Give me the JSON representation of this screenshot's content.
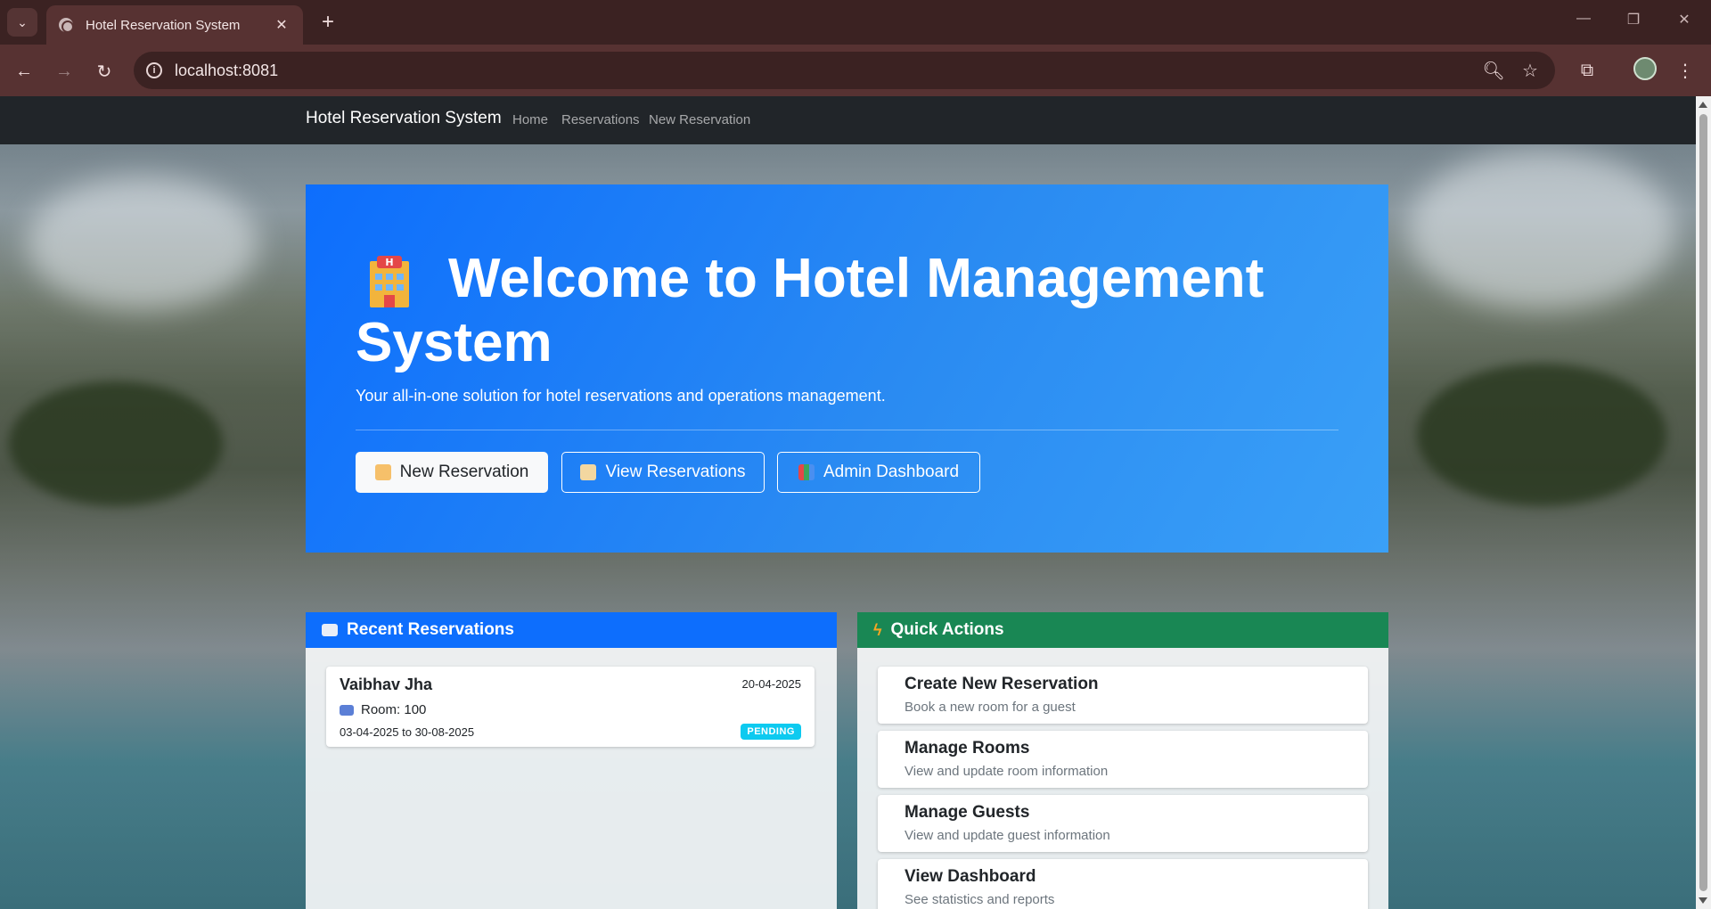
{
  "browser": {
    "tab_title": "Hotel Reservation System",
    "url": "localhost:8081"
  },
  "navbar": {
    "brand": "Hotel Reservation System",
    "links": [
      "Home",
      "Reservations",
      "New Reservation"
    ]
  },
  "hero": {
    "title": "Welcome to Hotel Management System",
    "subtitle": "Your all-in-one solution for hotel reservations and operations management.",
    "buttons": [
      "New Reservation",
      "View Reservations",
      "Admin Dashboard"
    ]
  },
  "recent": {
    "header": "Recent Reservations",
    "items": [
      {
        "guest": "Vaibhav Jha",
        "date": "20-04-2025",
        "room": "Room: 100",
        "range": "03-04-2025 to 30-08-2025",
        "status": "PENDING"
      }
    ]
  },
  "quick_actions": {
    "header": "Quick Actions",
    "items": [
      {
        "title": "Create New Reservation",
        "desc": "Book a new room for a guest"
      },
      {
        "title": "Manage Rooms",
        "desc": "View and update room information"
      },
      {
        "title": "Manage Guests",
        "desc": "View and update guest information"
      },
      {
        "title": "View Dashboard",
        "desc": "See statistics and reports"
      }
    ]
  },
  "colors": {
    "primary": "#0d6efd",
    "success": "#198754",
    "info": "#0dcaf0",
    "navbar": "#212529"
  }
}
